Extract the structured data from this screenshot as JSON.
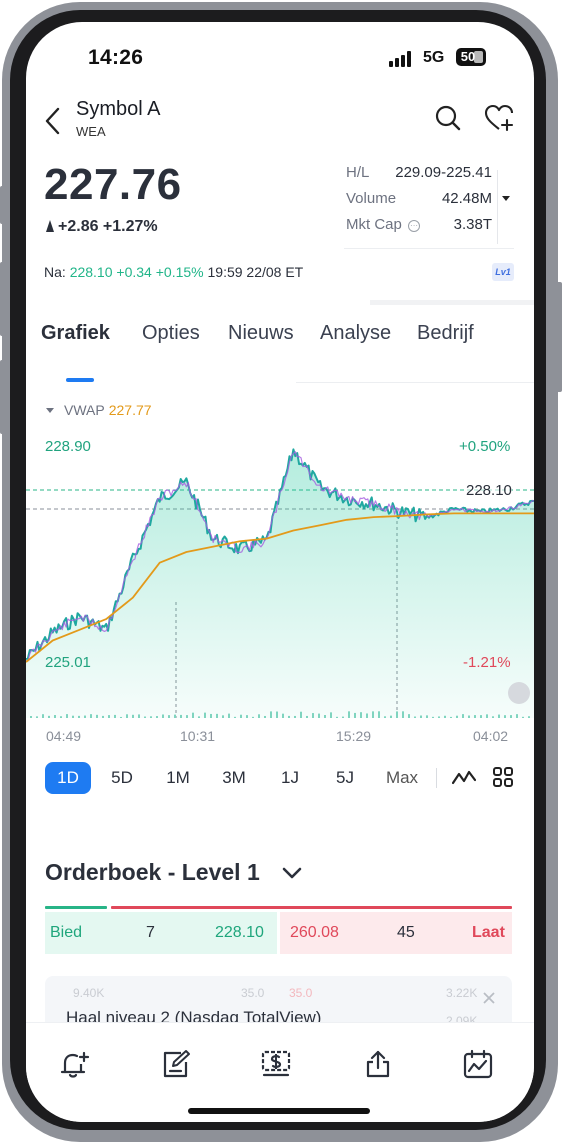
{
  "status": {
    "time": "14:26",
    "network": "5G",
    "battery": "50"
  },
  "header": {
    "title": "Symbol A",
    "subtitle": "WEA"
  },
  "quote": {
    "price": "227.76",
    "change": "+2.86 +1.27%",
    "stats": [
      {
        "label": "H/L",
        "value": "229.09-225.41"
      },
      {
        "label": "Volume",
        "value": "42.48M"
      },
      {
        "label": "Mkt Cap",
        "value": "3.38T"
      }
    ],
    "after_hours": {
      "label": "Na:",
      "price": "228.10",
      "change": "+0.34",
      "pct": "+0.15%",
      "time": "19:59 22/08 ET"
    },
    "level_badge": "Lv1"
  },
  "tabs": [
    "Grafiek",
    "Opties",
    "Nieuws",
    "Analyse",
    "Bedrijf"
  ],
  "chart": {
    "indicator": "VWAP",
    "indicator_value": "227.77",
    "y_high": "228.90",
    "y_low": "225.01",
    "pct_high": "+0.50%",
    "pct_low": "-1.21%",
    "last_label": "228.10",
    "x_labels": [
      "04:49",
      "10:31",
      "15:29",
      "04:02"
    ]
  },
  "chart_data": {
    "type": "area",
    "title": "",
    "xlabel": "",
    "ylabel": "",
    "ylim": [
      225.0,
      229.1
    ],
    "x": [
      "04:49",
      "07:00",
      "09:00",
      "09:30",
      "10:00",
      "10:31",
      "11:00",
      "11:30",
      "12:00",
      "12:30",
      "13:00",
      "13:30",
      "14:00",
      "14:30",
      "15:00",
      "15:29",
      "16:00",
      "18:00",
      "20:00",
      "04:02"
    ],
    "series": [
      {
        "name": "",
        "values": [
          225.05,
          225.55,
          225.85,
          225.6,
          226.9,
          228.05,
          228.35,
          227.3,
          227.1,
          227.25,
          228.95,
          228.25,
          228.05,
          227.95,
          227.8,
          227.7,
          227.85,
          227.8,
          227.85,
          228.0
        ]
      },
      {
        "name": "VWAP",
        "values": [
          225.0,
          225.4,
          225.6,
          225.8,
          226.2,
          226.85,
          227.05,
          227.15,
          227.25,
          227.3,
          227.45,
          227.55,
          227.65,
          227.7,
          227.72,
          227.75,
          227.77,
          227.77,
          227.77,
          227.77
        ]
      }
    ]
  },
  "periods": [
    "1D",
    "5D",
    "1M",
    "3M",
    "1J",
    "5J",
    "Max"
  ],
  "orderbook": {
    "title": "Orderboek - Level 1",
    "bid_label": "Bied",
    "bid_size": "7",
    "bid_price": "228.10",
    "ask_price": "260.08",
    "ask_size": "45",
    "ask_label": "Laat"
  },
  "level2_card": {
    "text": "Haal niveau 2 (Nasdaq TotalView)",
    "ghost": [
      "9.40K",
      "35.0",
      "35.0",
      "3.22K",
      "2.09K"
    ]
  },
  "colors": {
    "accent": "#1e7bf2",
    "up": "#21b589",
    "down": "#e0485a",
    "vwap": "#e39a1a"
  }
}
